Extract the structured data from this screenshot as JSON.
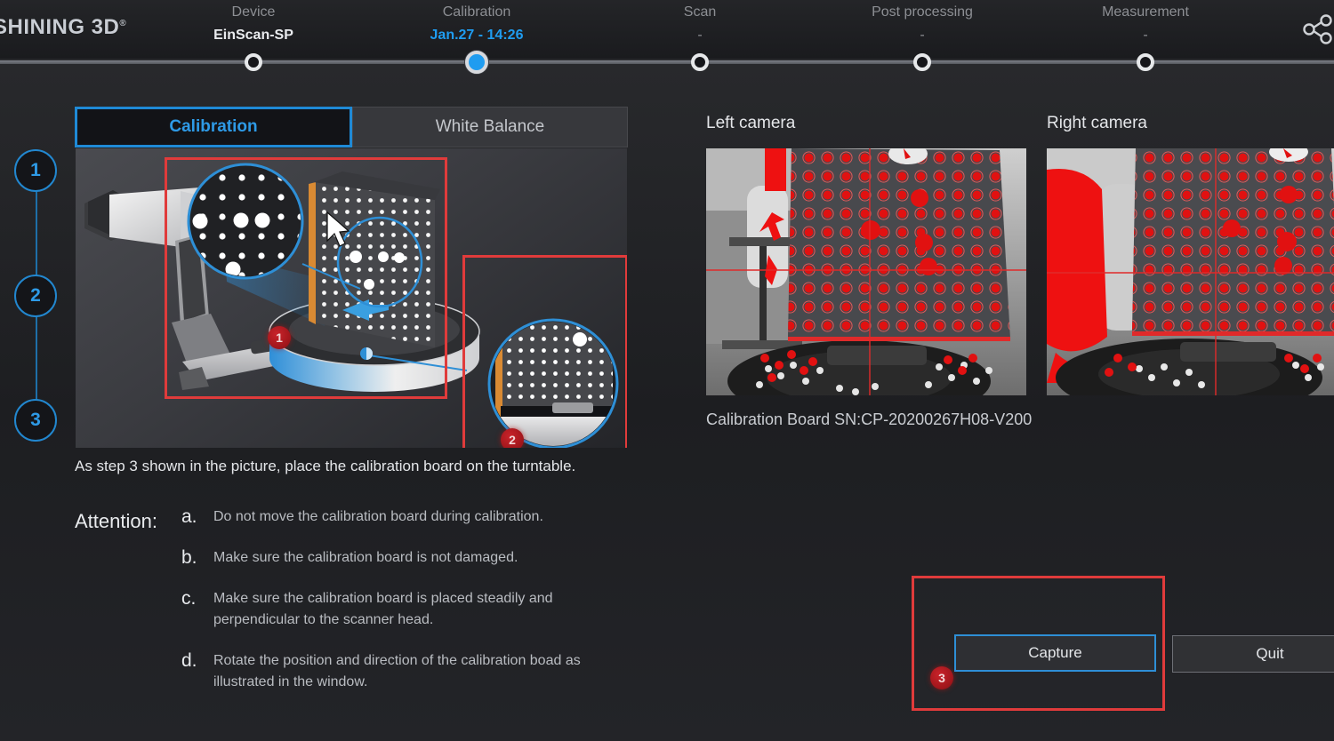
{
  "app": {
    "brand": "SHINING 3D",
    "brand_mark": "®",
    "share_icon": "share-network-icon",
    "accent_blue": "#1f9cf0",
    "accent_red": "#e03b3b",
    "background": "#1d1e21"
  },
  "workflow": {
    "steps": [
      {
        "title": "Device",
        "value": "EinScan-SP",
        "state": "done"
      },
      {
        "title": "Calibration",
        "value": "Jan.27 - 14:26",
        "state": "active"
      },
      {
        "title": "Scan",
        "value": "-",
        "state": "pending"
      },
      {
        "title": "Post processing",
        "value": "-",
        "state": "pending"
      },
      {
        "title": "Measurement",
        "value": "-",
        "state": "pending"
      }
    ]
  },
  "rail": {
    "items": [
      "1",
      "2",
      "3"
    ],
    "current": "3"
  },
  "tabs": [
    {
      "label": "Calibration",
      "active": true
    },
    {
      "label": "White Balance",
      "active": false
    }
  ],
  "illustration": {
    "markers": [
      "1",
      "2"
    ],
    "cursor": "mouse-pointer-icon"
  },
  "caption": "As step 3 shown in the picture, place the calibration board on the turntable.",
  "attention": {
    "heading": "Attention:",
    "items": [
      {
        "marker": "a.",
        "text": "Do not move the calibration board during calibration."
      },
      {
        "marker": "b.",
        "text": "Make sure the calibration board is not damaged."
      },
      {
        "marker": "c.",
        "text": "Make sure the calibration board is placed steadily and perpendicular to the scanner head."
      },
      {
        "marker": "d.",
        "text": "Rotate the position and direction of the calibration boad as illustrated in the window."
      }
    ]
  },
  "cameras": {
    "left_label": "Left camera",
    "right_label": "Right camera",
    "serial_text": "Calibration Board SN:CP-20200267H08-V200"
  },
  "actions": {
    "capture_label": "Capture",
    "quit_label": "Quit",
    "highlight_marker": "3"
  }
}
